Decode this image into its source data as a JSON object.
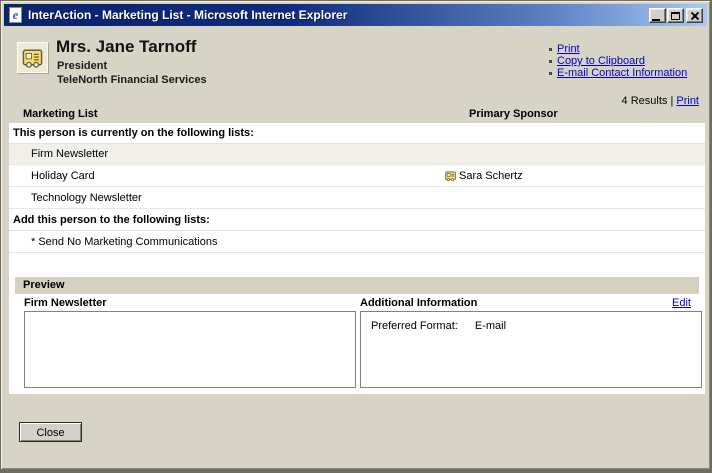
{
  "window": {
    "title": "InterAction - Marketing List - Microsoft Internet Explorer"
  },
  "header": {
    "name": "Mrs. Jane Tarnoff",
    "job_title": "President",
    "company": "TeleNorth Financial Services",
    "links": [
      "Print",
      "Copy to Clipboard",
      "E-mail Contact Information"
    ],
    "results_count": "4 Results",
    "results_separator": "|",
    "results_print_link": "Print"
  },
  "table": {
    "columns": [
      "Marketing List",
      "Primary Sponsor"
    ],
    "current_section_label": "This person is currently on the following lists:",
    "current_rows": [
      {
        "name": "Firm Newsletter",
        "sponsor": ""
      },
      {
        "name": "Holiday Card",
        "sponsor": "Sara Schertz"
      },
      {
        "name": "Technology Newsletter",
        "sponsor": ""
      }
    ],
    "add_section_label": "Add this person to the following lists:",
    "add_rows": [
      {
        "name": "* Send No Marketing Communications"
      }
    ]
  },
  "preview": {
    "title": "Preview",
    "left_panel": {
      "label": "Firm Newsletter",
      "content": ""
    },
    "right_panel": {
      "label": "Additional Information",
      "edit_link": "Edit",
      "field_label": "Preferred Format:",
      "field_value": "E-mail"
    }
  },
  "footer": {
    "close_label": "Close"
  },
  "colors": {
    "titlebar_left": "#0a246a",
    "titlebar_right": "#a6caf0",
    "chrome": "#d8d4c5",
    "preview_bar": "#d5d1c1",
    "link": "#0000cc",
    "row_shaded": "#f0efe9",
    "card_icon_yellow": "#f3df76"
  }
}
